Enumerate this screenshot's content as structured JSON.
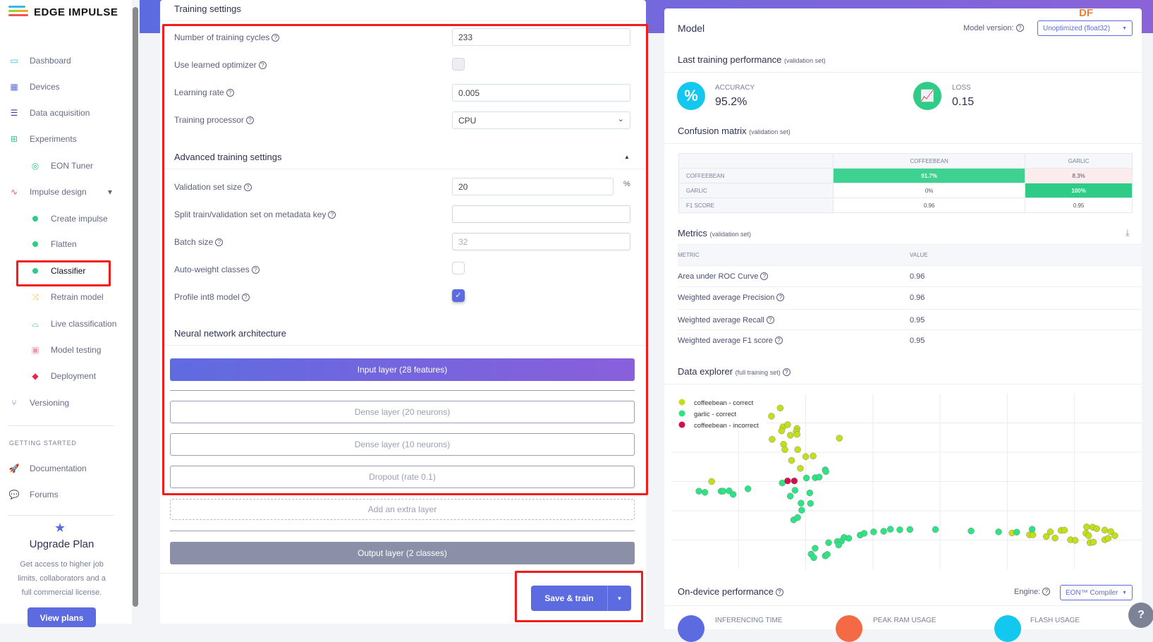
{
  "app": {
    "brand": "EDGE IMPULSE",
    "watermark": "DF"
  },
  "sidebar": {
    "items": [
      {
        "label": "Dashboard",
        "icon": "monitor-icon"
      },
      {
        "label": "Devices",
        "icon": "chip-icon"
      },
      {
        "label": "Data acquisition",
        "icon": "database-icon"
      },
      {
        "label": "Experiments",
        "icon": "table-icon"
      },
      {
        "label": "EON Tuner",
        "icon": "compass-icon"
      },
      {
        "label": "Impulse design",
        "icon": "pulse-icon"
      },
      {
        "label": "Create impulse",
        "icon": "dot-icon"
      },
      {
        "label": "Flatten",
        "icon": "dot-icon"
      },
      {
        "label": "Classifier",
        "icon": "dot-icon",
        "active": true
      },
      {
        "label": "Retrain model",
        "icon": "shuffle-icon"
      },
      {
        "label": "Live classification",
        "icon": "live-icon"
      },
      {
        "label": "Model testing",
        "icon": "clipboard-check-icon"
      },
      {
        "label": "Deployment",
        "icon": "box-icon"
      },
      {
        "label": "Versioning",
        "icon": "branch-icon"
      }
    ],
    "getting_started": "GETTING STARTED",
    "gs_items": [
      {
        "label": "Documentation",
        "icon": "rocket-icon"
      },
      {
        "label": "Forums",
        "icon": "chat-icon"
      }
    ],
    "upgrade": {
      "title": "Upgrade Plan",
      "text": [
        "Get access to higher job",
        "limits, collaborators and a",
        "full commercial license."
      ],
      "button": "View plans"
    }
  },
  "training": {
    "title": "Training settings",
    "cycles_label": "Number of training cycles",
    "cycles": "233",
    "optimizer_label": "Use learned optimizer",
    "optimizer": false,
    "lr_label": "Learning rate",
    "lr": "0.005",
    "processor_label": "Training processor",
    "processor": "CPU",
    "advanced_title": "Advanced training settings",
    "val_label": "Validation set size",
    "val": "20",
    "val_unit": "%",
    "split_label": "Split train/validation set on metadata key",
    "split": "",
    "batch_label": "Batch size",
    "batch_placeholder": "32",
    "autoweight_label": "Auto-weight classes",
    "autoweight": false,
    "int8_label": "Profile int8 model",
    "int8": true,
    "nn_title": "Neural network architecture",
    "input_layer": "Input layer (28 features)",
    "layers": [
      "Dense layer (20 neurons)",
      "Dense layer (10 neurons)",
      "Dropout (rate 0.1)"
    ],
    "add_layer": "Add an extra layer",
    "output_layer": "Output layer (2 classes)",
    "save_train": "Save & train"
  },
  "model": {
    "title": "Model",
    "version_label": "Model version:",
    "version": "Unoptimized (float32)",
    "perf_title": "Last training performance",
    "perf_sub": "(validation set)",
    "accuracy_label": "ACCURACY",
    "accuracy": "95.2%",
    "loss_label": "LOSS",
    "loss": "0.15",
    "cm_title": "Confusion matrix",
    "cm_sub": "(validation set)",
    "cm": {
      "cols": [
        "COFFEEBEAN",
        "GARLIC"
      ],
      "rows": [
        {
          "label": "COFFEEBEAN",
          "cells": [
            "91.7%",
            "8.3%"
          ]
        },
        {
          "label": "GARLIC",
          "cells": [
            "0%",
            "100%"
          ]
        },
        {
          "label": "F1 SCORE",
          "cells": [
            "0.96",
            "0.95"
          ]
        }
      ]
    },
    "metrics_title": "Metrics",
    "metrics_sub": "(validation set)",
    "metrics_head": [
      "METRIC",
      "VALUE"
    ],
    "metrics": [
      {
        "name": "Area under ROC Curve",
        "value": "0.96"
      },
      {
        "name": "Weighted average Precision",
        "value": "0.96"
      },
      {
        "name": "Weighted average Recall",
        "value": "0.95"
      },
      {
        "name": "Weighted average F1 score",
        "value": "0.95"
      }
    ],
    "explorer_title": "Data explorer",
    "explorer_sub": "(full training set)",
    "ondevice_title": "On-device performance",
    "engine_label": "Engine:",
    "engine": "EON™ Compiler",
    "ondevice_stats": [
      "INFERENCING TIME",
      "PEAK RAM USAGE",
      "FLASH USAGE"
    ]
  },
  "colors": {
    "accent": "#5c6ce0",
    "coffee_correct": "#c4de1a",
    "garlic_correct": "#2ee383",
    "coffee_incorrect": "#d0124c",
    "cm_high": "#3dd28f",
    "cm_low_bad": "#fdecee"
  },
  "chart_data": {
    "type": "scatter",
    "grid": true,
    "legend": "top-left",
    "xlim": [
      0,
      7
    ],
    "ylim": [
      0,
      6
    ],
    "series": [
      {
        "name": "coffeebean - correct",
        "color": "#c4de1a",
        "points": [
          [
            1.62,
            5.51
          ],
          [
            1.49,
            5.23
          ],
          [
            1.66,
            4.86
          ],
          [
            1.73,
            4.94
          ],
          [
            1.64,
            4.73
          ],
          [
            1.87,
            4.81
          ],
          [
            1.86,
            4.71
          ],
          [
            1.87,
            4.61
          ],
          [
            1.77,
            4.58
          ],
          [
            1.5,
            4.44
          ],
          [
            2.5,
            4.48
          ],
          [
            1.67,
            4.27
          ],
          [
            1.69,
            4.09
          ],
          [
            1.88,
            4.09
          ],
          [
            2.0,
            3.85
          ],
          [
            2.11,
            3.87
          ],
          [
            1.79,
            3.72
          ],
          [
            1.92,
            3.45
          ],
          [
            0.6,
            3.0
          ],
          [
            5.07,
            1.24
          ],
          [
            5.33,
            1.18
          ],
          [
            5.38,
            1.18
          ],
          [
            5.58,
            1.12
          ],
          [
            5.64,
            1.28
          ],
          [
            5.71,
            1.07
          ],
          [
            5.8,
            1.33
          ],
          [
            5.85,
            1.34
          ],
          [
            5.94,
            1.01
          ],
          [
            6.01,
            0.99
          ],
          [
            6.18,
            1.45
          ],
          [
            6.27,
            1.44
          ],
          [
            6.33,
            1.39
          ],
          [
            6.17,
            1.23
          ],
          [
            6.21,
            1.15
          ],
          [
            6.23,
            0.91
          ],
          [
            6.28,
            0.93
          ],
          [
            6.45,
            1.34
          ],
          [
            6.54,
            1.29
          ],
          [
            6.6,
            1.15
          ],
          [
            6.45,
            1.01
          ],
          [
            6.5,
            1.06
          ]
        ]
      },
      {
        "name": "garlic - correct",
        "color": "#2ee383",
        "points": [
          [
            0.41,
            2.67
          ],
          [
            0.5,
            2.63
          ],
          [
            0.74,
            2.67
          ],
          [
            0.77,
            2.67
          ],
          [
            0.86,
            2.68
          ],
          [
            0.92,
            2.56
          ],
          [
            1.14,
            2.75
          ],
          [
            1.65,
            2.95
          ],
          [
            1.84,
            2.7
          ],
          [
            1.77,
            2.5
          ],
          [
            2.06,
            2.61
          ],
          [
            1.93,
            2.26
          ],
          [
            2.07,
            2.25
          ],
          [
            1.94,
            2.02
          ],
          [
            1.82,
            1.69
          ],
          [
            1.88,
            1.77
          ],
          [
            2.01,
            3.12
          ],
          [
            2.14,
            3.13
          ],
          [
            2.2,
            3.15
          ],
          [
            2.29,
            3.4
          ],
          [
            2.3,
            3.34
          ],
          [
            2.08,
            0.52
          ],
          [
            2.12,
            0.4
          ],
          [
            2.14,
            0.72
          ],
          [
            2.29,
            0.46
          ],
          [
            2.32,
            0.51
          ],
          [
            2.34,
            0.91
          ],
          [
            2.47,
            0.95
          ],
          [
            2.53,
            0.96
          ],
          [
            2.49,
            0.83
          ],
          [
            2.57,
            1.09
          ],
          [
            2.64,
            1.06
          ],
          [
            2.81,
            1.17
          ],
          [
            2.87,
            1.23
          ],
          [
            3.01,
            1.28
          ],
          [
            3.16,
            1.3
          ],
          [
            3.26,
            1.37
          ],
          [
            3.4,
            1.35
          ],
          [
            3.55,
            1.36
          ],
          [
            3.93,
            1.36
          ],
          [
            4.46,
            1.31
          ],
          [
            4.87,
            1.28
          ],
          [
            5.14,
            1.27
          ],
          [
            5.37,
            1.37
          ]
        ]
      },
      {
        "name": "coffeebean - incorrect",
        "color": "#d0124c",
        "points": [
          [
            1.73,
            3.02
          ],
          [
            1.83,
            3.02
          ]
        ]
      }
    ]
  }
}
